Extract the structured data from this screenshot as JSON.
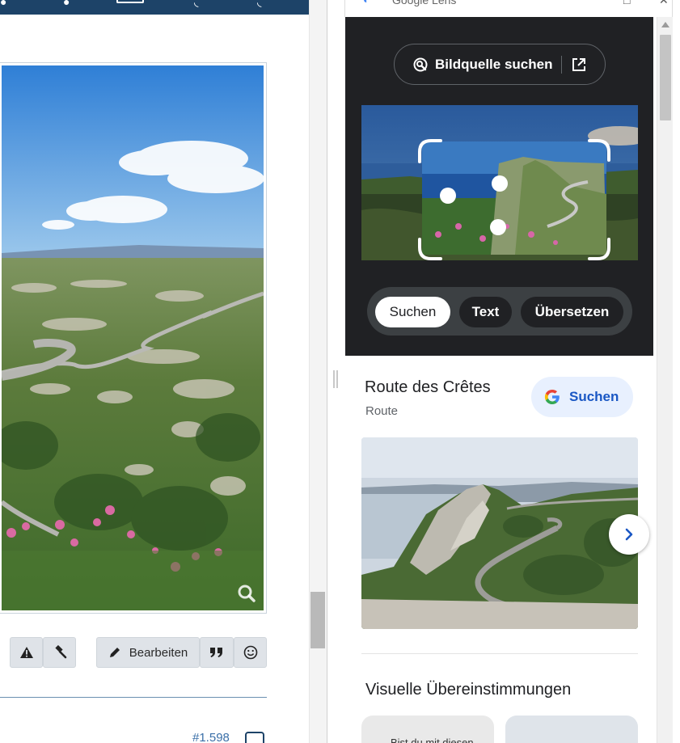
{
  "forum": {
    "toolbar": {
      "edit_label": "Bearbeiten"
    },
    "post_number": "#1.598"
  },
  "lens": {
    "header_title": "Google Lens",
    "source_button": "Bildquelle suchen",
    "tabs": [
      "Suchen",
      "Text",
      "Übersetzen"
    ],
    "result": {
      "title": "Route des Crêtes",
      "subtitle": "Route",
      "search_button": "Suchen"
    },
    "matches_heading": "Visuelle Übereinstimmungen",
    "match_card_text": "Bist du mit diesen"
  },
  "colors": {
    "forum_header": "#1d4368",
    "lens_dark": "#202124",
    "google_blue": "#1a57c4",
    "pill_bg": "#e8f0fe"
  },
  "icons": {
    "source_button": [
      "image-search-icon",
      "open-external-icon"
    ],
    "toolbar": [
      "warning-icon",
      "gavel-icon",
      "pencil-icon",
      "quote-icon",
      "smiley-icon"
    ],
    "photo": "magnifier-icon",
    "result": [
      "google-g-icon",
      "chevron-right-icon"
    ]
  }
}
